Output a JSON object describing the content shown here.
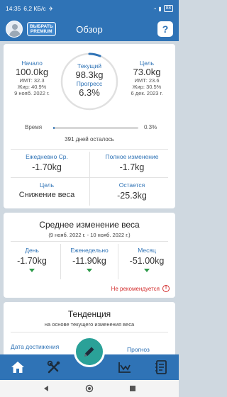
{
  "status": {
    "time": "14:35",
    "speed": "6,2 КБ/с",
    "battery": "88"
  },
  "header": {
    "premium_line1": "ВЫБРАТЬ",
    "premium_line2": "PREMIUM",
    "title": "Обзор",
    "help": "?"
  },
  "overview": {
    "start": {
      "label": "Начало",
      "value": "100.0kg",
      "bmi": "ИМТ: 32.3",
      "fat": "Жир: 40.9%",
      "date": "9 нояб. 2022 г."
    },
    "current": {
      "label": "Текущий",
      "value": "98.3kg",
      "progress_label": "Прогресс",
      "progress_value": "6.3%"
    },
    "goal": {
      "label": "Цель",
      "value": "73.0kg",
      "bmi": "ИМТ: 23.6",
      "fat": "Жир: 30.5%",
      "date": "6 дек. 2023 г."
    },
    "ring_progress_fraction": 0.063,
    "time_label": "Время",
    "time_value": "0.3%",
    "time_fraction": 0.003,
    "days_left": "391 дней осталось",
    "daily_avg": {
      "label": "Ежедневно Ср.",
      "value": "-1.70kg"
    },
    "total_change": {
      "label": "Полное изменение",
      "value": "-1.7kg"
    },
    "goal_type": {
      "label": "Цель",
      "value": "Снижение веса"
    },
    "remaining": {
      "label": "Остается",
      "value": "-25.3kg"
    }
  },
  "avg_change": {
    "title": "Среднее изменение веса",
    "range": "(9 нояб. 2022 г. - 10 нояб. 2022 г.)",
    "day": {
      "label": "День",
      "value": "-1.70kg"
    },
    "week": {
      "label": "Еженедельно",
      "value": "-11.90kg"
    },
    "month": {
      "label": "Месяц",
      "value": "-51.00kg"
    },
    "warning": "Не рекомендуется",
    "warning_icon": "!"
  },
  "trend": {
    "title": "Тенденция",
    "subtitle": "на основе текущего изменения веса",
    "left_label": "Дата достижения",
    "right_label": "Прогноз"
  },
  "colors": {
    "accent": "#2f73b6",
    "fab": "#2aa198",
    "down": "#2e9a4a",
    "warn": "#d32f2f"
  }
}
